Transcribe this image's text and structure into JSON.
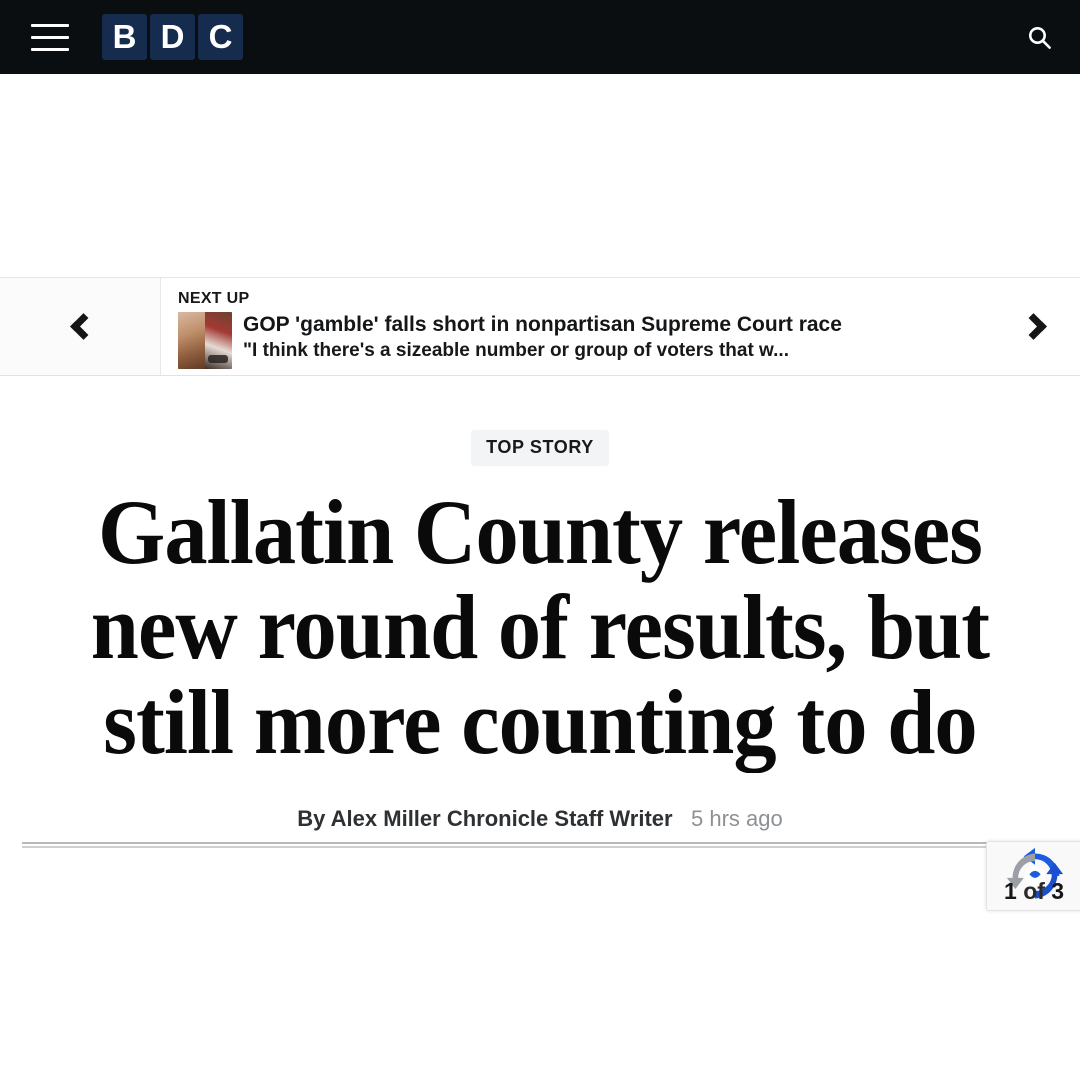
{
  "header": {
    "menu_icon": "hamburger-menu-icon",
    "logo_tiles": [
      "B",
      "D",
      "C"
    ],
    "logo_color": "#152c4f",
    "bar_color": "#0b0e11",
    "search_icon": "search-icon"
  },
  "carousel": {
    "prev_icon": "chevron-left-icon",
    "next_icon": "chevron-right-icon",
    "kicker": "NEXT UP",
    "thumbnail_icon": "article-thumbnail-image",
    "title": "GOP 'gamble' falls short in nonpartisan Supreme Court race",
    "subtitle": "\"I think there's a sizeable number or group of voters that w..."
  },
  "article": {
    "label": "TOP STORY",
    "label_bg": "#f3f4f5",
    "headline": "Gallatin County releases new round of results, but still more counting to do",
    "author": "By Alex Miller Chronicle Staff Writer",
    "timestamp": "5 hrs ago"
  },
  "recaptcha": {
    "icon": "recaptcha-logo-icon",
    "blue": "#1c5ce0",
    "gray": "#9aa0a6"
  },
  "slide_counter": {
    "current": "1",
    "separator": "of",
    "total": "3"
  }
}
